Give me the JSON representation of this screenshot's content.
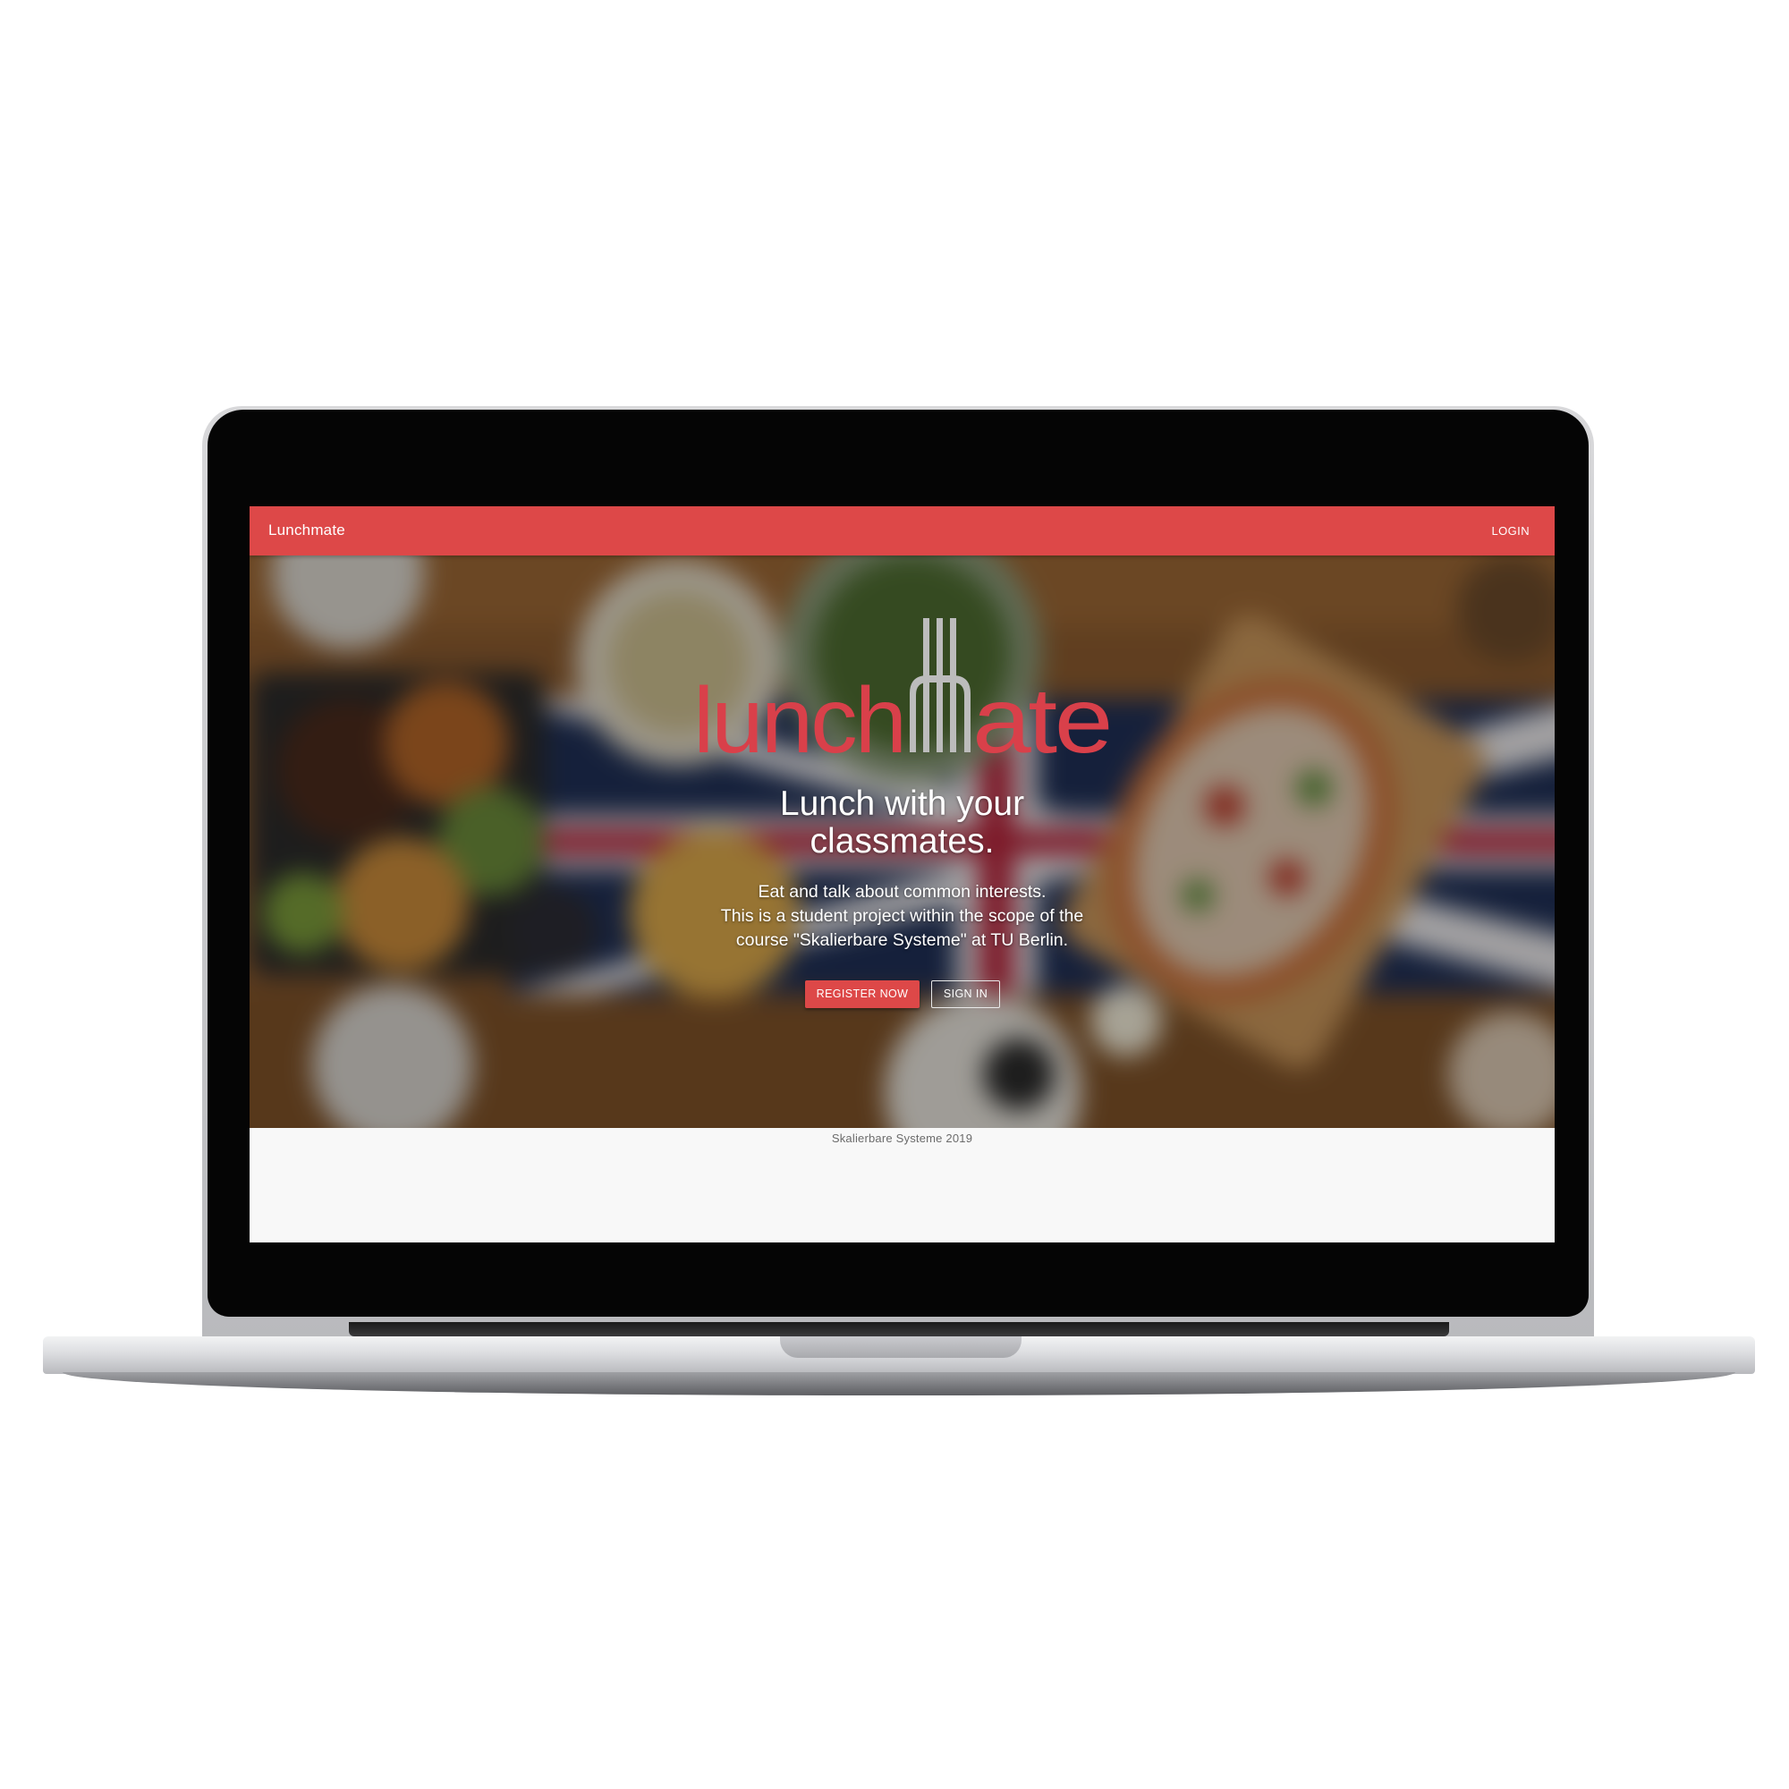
{
  "navbar": {
    "brand": "Lunchmate",
    "login_label": "LOGIN"
  },
  "hero": {
    "logo_text": "lunchmate",
    "headline_line1": "Lunch with your",
    "headline_line2": "classmates.",
    "subtext_line1": "Eat and talk about common interests.",
    "subtext_line2": "This is a student project within the scope of the",
    "subtext_line3": "course \"Skalierbare Systeme\" at TU Berlin.",
    "register_label": "REGISTER NOW",
    "signin_label": "SIGN IN"
  },
  "footer": {
    "text": "Skalierbare Systeme 2019"
  },
  "colors": {
    "accent": "#dd4848",
    "logo_red": "#d9404a",
    "fork_gray": "#b9b9b9",
    "page_bg": "#f8f8f8"
  }
}
